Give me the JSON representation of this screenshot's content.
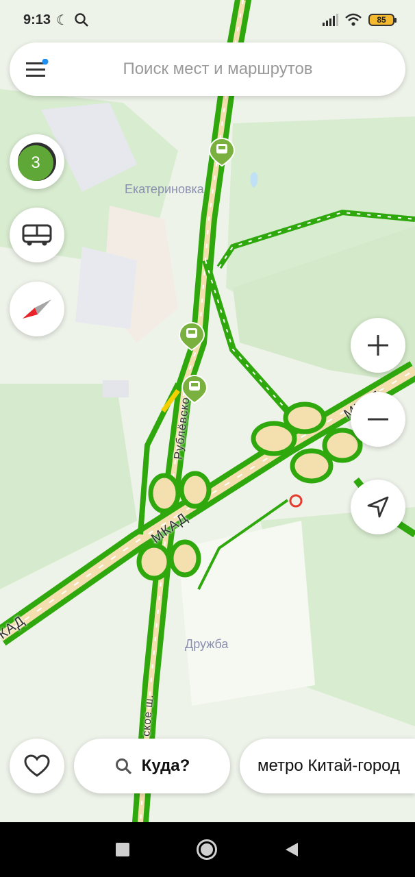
{
  "status_bar": {
    "time": "9:13",
    "battery": "85"
  },
  "search": {
    "placeholder": "Поиск мест и маршрутов"
  },
  "traffic": {
    "level": "3"
  },
  "map": {
    "labels": {
      "ekaterinovka": "Екатериновка",
      "druzhba": "Дружба",
      "rublevskoe": "Рублёвско",
      "mkad_1": "МКАД",
      "mkad_2": "МКАД",
      "mkad_3": "КАД",
      "shosse": "ское ш."
    }
  },
  "bottom": {
    "where_label": "Куда?",
    "suggestion": "метро Китай-город"
  },
  "colors": {
    "traffic_green": "#2fa80d",
    "traffic_yellow": "#f5d000",
    "road_fill": "#f4dfae",
    "accent_blue": "#1f8ef1"
  }
}
